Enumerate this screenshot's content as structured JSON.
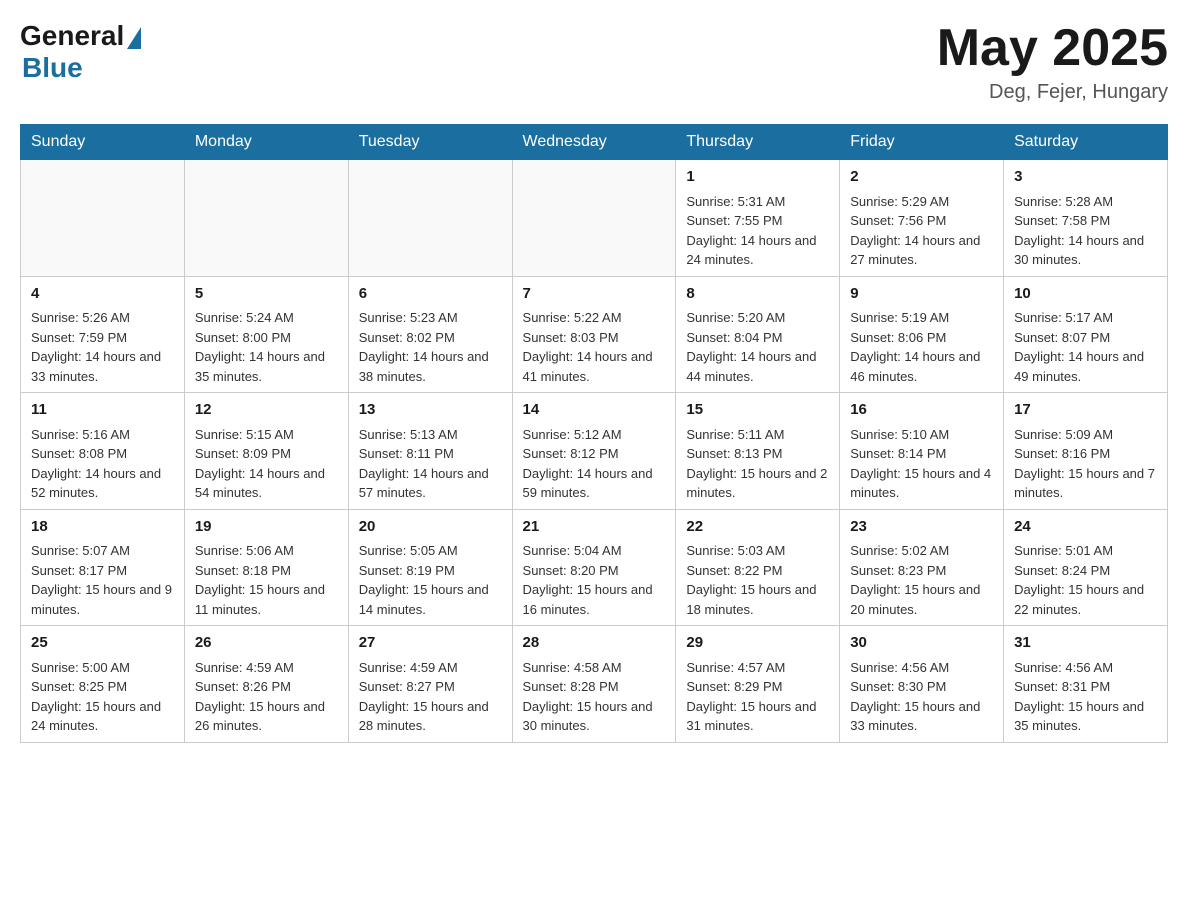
{
  "header": {
    "logo_general": "General",
    "logo_blue": "Blue",
    "title": "May 2025",
    "subtitle": "Deg, Fejer, Hungary"
  },
  "calendar": {
    "days_of_week": [
      "Sunday",
      "Monday",
      "Tuesday",
      "Wednesday",
      "Thursday",
      "Friday",
      "Saturday"
    ],
    "weeks": [
      [
        {
          "day": "",
          "info": ""
        },
        {
          "day": "",
          "info": ""
        },
        {
          "day": "",
          "info": ""
        },
        {
          "day": "",
          "info": ""
        },
        {
          "day": "1",
          "info": "Sunrise: 5:31 AM\nSunset: 7:55 PM\nDaylight: 14 hours and 24 minutes."
        },
        {
          "day": "2",
          "info": "Sunrise: 5:29 AM\nSunset: 7:56 PM\nDaylight: 14 hours and 27 minutes."
        },
        {
          "day": "3",
          "info": "Sunrise: 5:28 AM\nSunset: 7:58 PM\nDaylight: 14 hours and 30 minutes."
        }
      ],
      [
        {
          "day": "4",
          "info": "Sunrise: 5:26 AM\nSunset: 7:59 PM\nDaylight: 14 hours and 33 minutes."
        },
        {
          "day": "5",
          "info": "Sunrise: 5:24 AM\nSunset: 8:00 PM\nDaylight: 14 hours and 35 minutes."
        },
        {
          "day": "6",
          "info": "Sunrise: 5:23 AM\nSunset: 8:02 PM\nDaylight: 14 hours and 38 minutes."
        },
        {
          "day": "7",
          "info": "Sunrise: 5:22 AM\nSunset: 8:03 PM\nDaylight: 14 hours and 41 minutes."
        },
        {
          "day": "8",
          "info": "Sunrise: 5:20 AM\nSunset: 8:04 PM\nDaylight: 14 hours and 44 minutes."
        },
        {
          "day": "9",
          "info": "Sunrise: 5:19 AM\nSunset: 8:06 PM\nDaylight: 14 hours and 46 minutes."
        },
        {
          "day": "10",
          "info": "Sunrise: 5:17 AM\nSunset: 8:07 PM\nDaylight: 14 hours and 49 minutes."
        }
      ],
      [
        {
          "day": "11",
          "info": "Sunrise: 5:16 AM\nSunset: 8:08 PM\nDaylight: 14 hours and 52 minutes."
        },
        {
          "day": "12",
          "info": "Sunrise: 5:15 AM\nSunset: 8:09 PM\nDaylight: 14 hours and 54 minutes."
        },
        {
          "day": "13",
          "info": "Sunrise: 5:13 AM\nSunset: 8:11 PM\nDaylight: 14 hours and 57 minutes."
        },
        {
          "day": "14",
          "info": "Sunrise: 5:12 AM\nSunset: 8:12 PM\nDaylight: 14 hours and 59 minutes."
        },
        {
          "day": "15",
          "info": "Sunrise: 5:11 AM\nSunset: 8:13 PM\nDaylight: 15 hours and 2 minutes."
        },
        {
          "day": "16",
          "info": "Sunrise: 5:10 AM\nSunset: 8:14 PM\nDaylight: 15 hours and 4 minutes."
        },
        {
          "day": "17",
          "info": "Sunrise: 5:09 AM\nSunset: 8:16 PM\nDaylight: 15 hours and 7 minutes."
        }
      ],
      [
        {
          "day": "18",
          "info": "Sunrise: 5:07 AM\nSunset: 8:17 PM\nDaylight: 15 hours and 9 minutes."
        },
        {
          "day": "19",
          "info": "Sunrise: 5:06 AM\nSunset: 8:18 PM\nDaylight: 15 hours and 11 minutes."
        },
        {
          "day": "20",
          "info": "Sunrise: 5:05 AM\nSunset: 8:19 PM\nDaylight: 15 hours and 14 minutes."
        },
        {
          "day": "21",
          "info": "Sunrise: 5:04 AM\nSunset: 8:20 PM\nDaylight: 15 hours and 16 minutes."
        },
        {
          "day": "22",
          "info": "Sunrise: 5:03 AM\nSunset: 8:22 PM\nDaylight: 15 hours and 18 minutes."
        },
        {
          "day": "23",
          "info": "Sunrise: 5:02 AM\nSunset: 8:23 PM\nDaylight: 15 hours and 20 minutes."
        },
        {
          "day": "24",
          "info": "Sunrise: 5:01 AM\nSunset: 8:24 PM\nDaylight: 15 hours and 22 minutes."
        }
      ],
      [
        {
          "day": "25",
          "info": "Sunrise: 5:00 AM\nSunset: 8:25 PM\nDaylight: 15 hours and 24 minutes."
        },
        {
          "day": "26",
          "info": "Sunrise: 4:59 AM\nSunset: 8:26 PM\nDaylight: 15 hours and 26 minutes."
        },
        {
          "day": "27",
          "info": "Sunrise: 4:59 AM\nSunset: 8:27 PM\nDaylight: 15 hours and 28 minutes."
        },
        {
          "day": "28",
          "info": "Sunrise: 4:58 AM\nSunset: 8:28 PM\nDaylight: 15 hours and 30 minutes."
        },
        {
          "day": "29",
          "info": "Sunrise: 4:57 AM\nSunset: 8:29 PM\nDaylight: 15 hours and 31 minutes."
        },
        {
          "day": "30",
          "info": "Sunrise: 4:56 AM\nSunset: 8:30 PM\nDaylight: 15 hours and 33 minutes."
        },
        {
          "day": "31",
          "info": "Sunrise: 4:56 AM\nSunset: 8:31 PM\nDaylight: 15 hours and 35 minutes."
        }
      ]
    ]
  }
}
